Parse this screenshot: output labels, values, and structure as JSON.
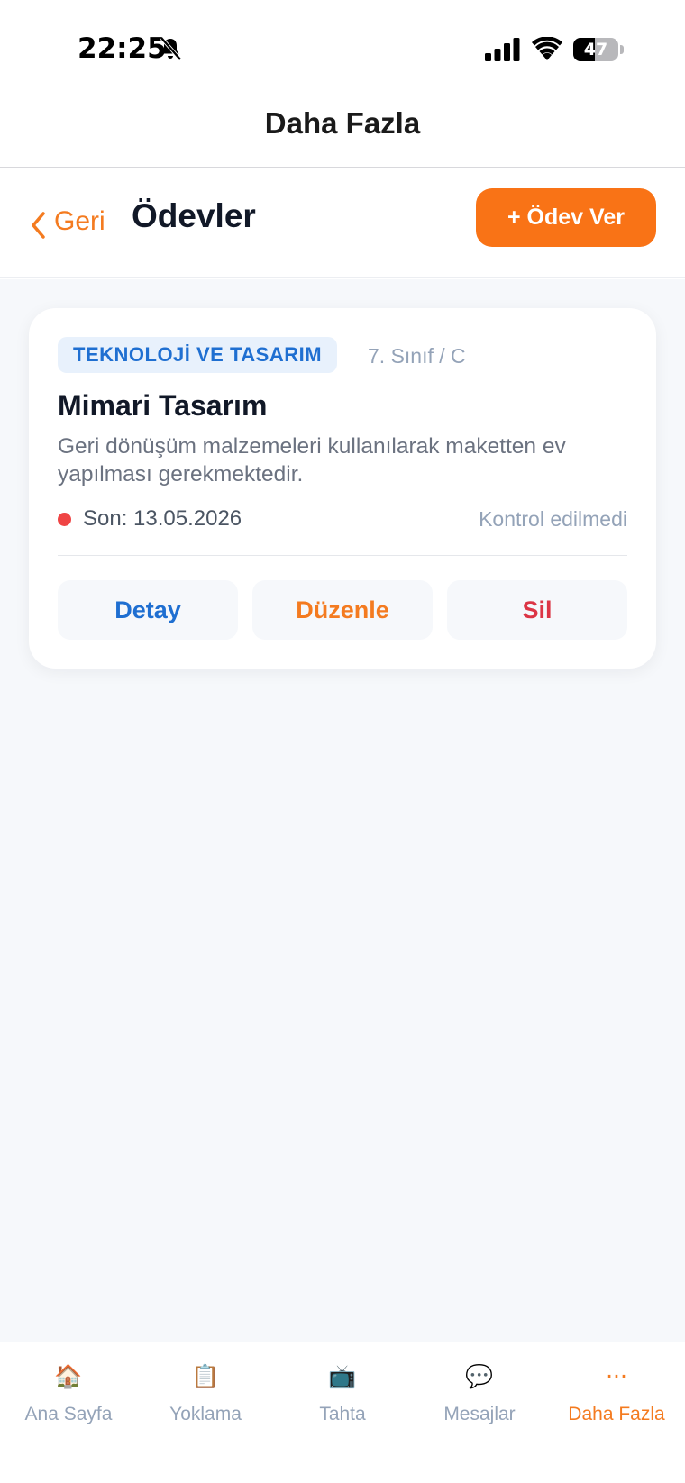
{
  "status_bar": {
    "time": "22:25",
    "battery": "47",
    "battery_level": 0.47
  },
  "nav": {
    "title": "Daha Fazla"
  },
  "header": {
    "back_label": "Geri",
    "title": "Ödevler",
    "add_button_label": "+ Ödev Ver"
  },
  "homework": {
    "subject": "TEKNOLOJİ VE TASARIM",
    "class": "7. Sınıf / C",
    "title": "Mimari Tasarım",
    "description": "Geri dönüşüm malzemeleri kullanılarak maketten ev yapılması gerekmektedir.",
    "due": "Son: 13.05.2026",
    "status": "Kontrol edilmedi",
    "actions": {
      "detail": "Detay",
      "edit": "Düzenle",
      "delete": "Sil"
    }
  },
  "tabs": [
    {
      "label": "Ana Sayfa",
      "icon": "house-icon",
      "glyph": "🏠"
    },
    {
      "label": "Yoklama",
      "icon": "clipboard-icon",
      "glyph": "📋"
    },
    {
      "label": "Tahta",
      "icon": "tv-icon",
      "glyph": "📺"
    },
    {
      "label": "Mesajlar",
      "icon": "speech-bubble-icon",
      "glyph": "💬"
    },
    {
      "label": "Daha Fazla",
      "icon": "ellipsis-icon",
      "glyph": "···",
      "active": true
    }
  ],
  "colors": {
    "accent": "#F97316",
    "link_blue": "#1F6FD1",
    "danger": "#DC3545",
    "muted": "#94A3B8"
  }
}
